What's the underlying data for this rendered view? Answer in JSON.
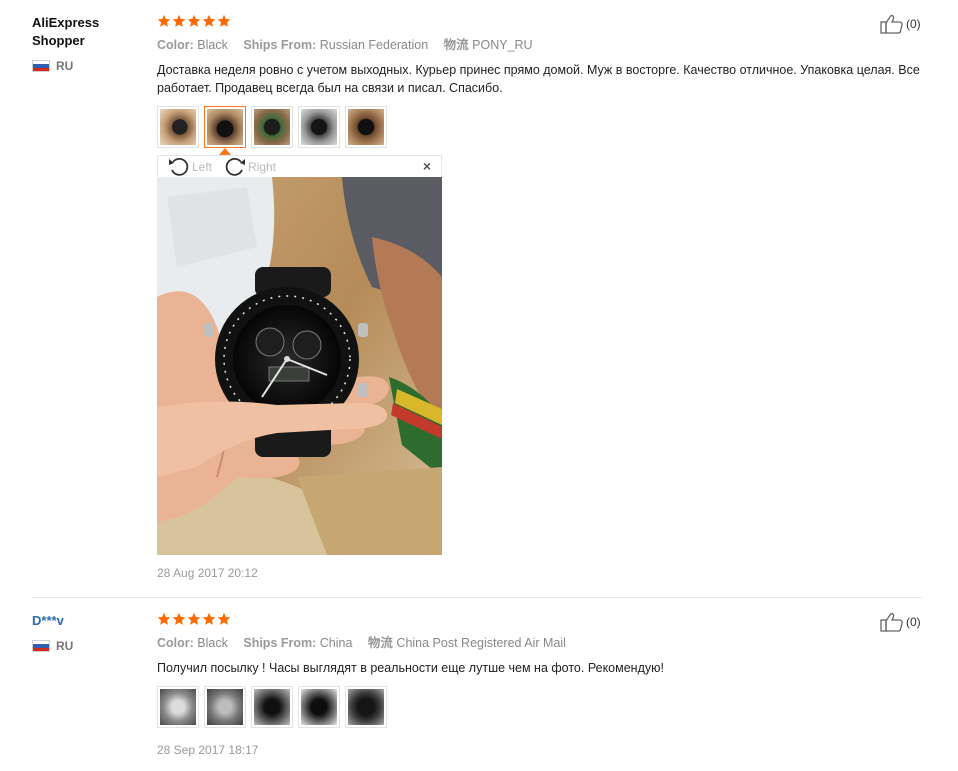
{
  "reviews": [
    {
      "user_name": "AliExpress Shopper",
      "country": "RU",
      "stars": 5,
      "helpful_count": "(0)",
      "color_label": "Color:",
      "color_value": "Black",
      "ships_label": "Ships From:",
      "ships_value": "Russian Federation",
      "logistics_label": "物流",
      "logistics_value": "PONY_RU",
      "text": "Доставка неделя ровно с учетом выходных. Курьер принес прямо домой. Муж в восторге. Качество отличное. Упаковка целая. Все работает. Продавец всегда был на связи и писал. Спасибо.",
      "photos_count": 5,
      "date": "28 Aug 2017 20:12"
    },
    {
      "user_name": "D***v",
      "country": "RU",
      "stars": 5,
      "helpful_count": "(0)",
      "color_label": "Color:",
      "color_value": "Black",
      "ships_label": "Ships From:",
      "ships_value": "China",
      "logistics_label": "物流",
      "logistics_value": "China Post Registered Air Mail",
      "text": "Получил посылку ! Часы выглядят в реальности еще лутше чем на фото. Рекомендую!",
      "photos_count": 5,
      "date": "28 Sep 2017 18:17"
    }
  ],
  "viewer": {
    "rotate_left": "Left",
    "rotate_right": "Right",
    "close": "×"
  },
  "colors": {
    "star": "#ff6a00",
    "active_thumb": "#ff7519",
    "masked_user": "#2b6cb0"
  }
}
